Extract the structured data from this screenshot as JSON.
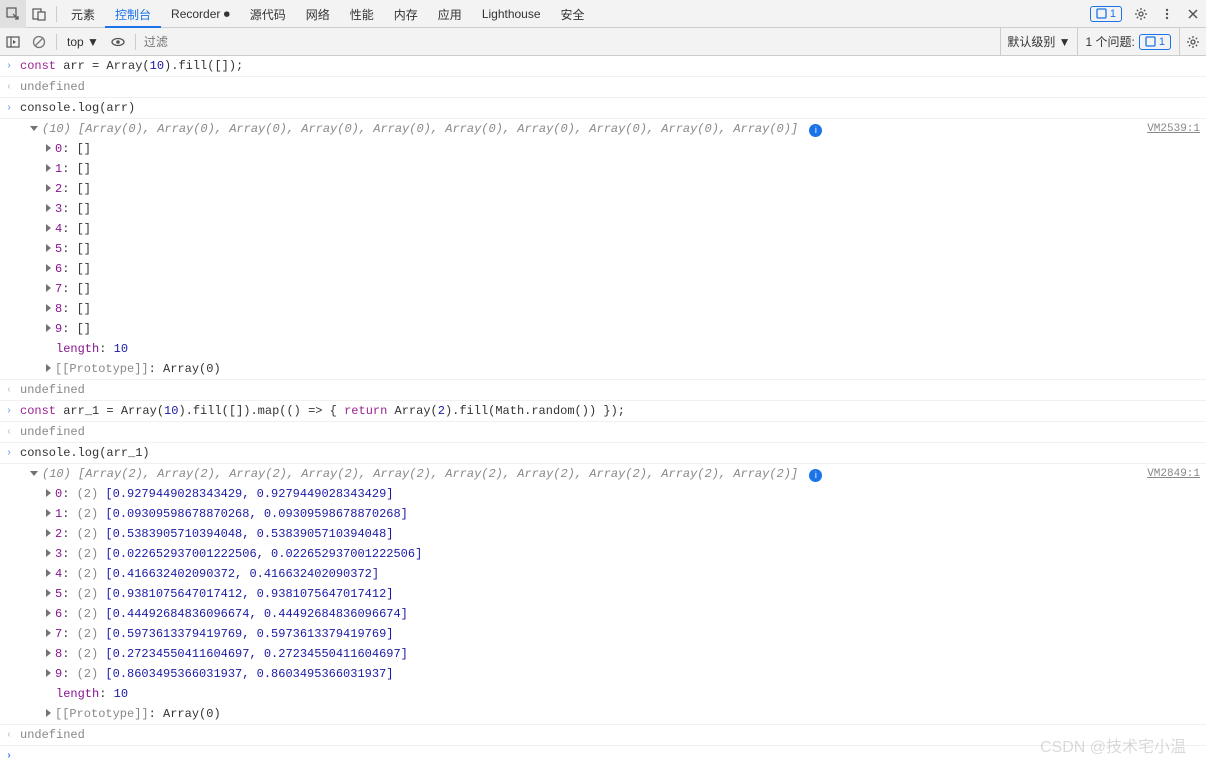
{
  "tabs": [
    "元素",
    "控制台",
    "Recorder ⏺",
    "源代码",
    "网络",
    "性能",
    "内存",
    "应用",
    "Lighthouse",
    "安全"
  ],
  "activeTab": "控制台",
  "issuesBadge": "1",
  "subbar": {
    "context": "top ▼",
    "filterPlaceholder": "过滤",
    "level": "默认级别 ▼",
    "issues": "1 个问题:",
    "issuesBadge": "1"
  },
  "lines": {
    "l1": "const arr = Array(10).fill([]);",
    "l2": "undefined",
    "l3": "console.log(arr)",
    "l4_summary": "(10) [Array(0), Array(0), Array(0), Array(0), Array(0), Array(0), Array(0), Array(0), Array(0), Array(0)]",
    "l4_source": "VM2539:1",
    "arr_items": [
      {
        "idx": "0",
        "val": "[]"
      },
      {
        "idx": "1",
        "val": "[]"
      },
      {
        "idx": "2",
        "val": "[]"
      },
      {
        "idx": "3",
        "val": "[]"
      },
      {
        "idx": "4",
        "val": "[]"
      },
      {
        "idx": "5",
        "val": "[]"
      },
      {
        "idx": "6",
        "val": "[]"
      },
      {
        "idx": "7",
        "val": "[]"
      },
      {
        "idx": "8",
        "val": "[]"
      },
      {
        "idx": "9",
        "val": "[]"
      }
    ],
    "length_label": "length",
    "length_val": "10",
    "proto_label": "[[Prototype]]",
    "proto_val": "Array(0)",
    "l5": "undefined",
    "l6": "const arr_1 = Array(10).fill([]).map(() => { return Array(2).fill(Math.random()) });",
    "l7": "undefined",
    "l8": "console.log(arr_1)",
    "l9_summary": "(10) [Array(2), Array(2), Array(2), Array(2), Array(2), Array(2), Array(2), Array(2), Array(2), Array(2)]",
    "l9_source": "VM2849:1",
    "arr1_items": [
      {
        "idx": "0",
        "count": "(2)",
        "v": "[0.9279449028343429, 0.9279449028343429]"
      },
      {
        "idx": "1",
        "count": "(2)",
        "v": "[0.09309598678870268, 0.09309598678870268]"
      },
      {
        "idx": "2",
        "count": "(2)",
        "v": "[0.5383905710394048, 0.5383905710394048]"
      },
      {
        "idx": "3",
        "count": "(2)",
        "v": "[0.022652937001222506, 0.022652937001222506]"
      },
      {
        "idx": "4",
        "count": "(2)",
        "v": "[0.416632402090372, 0.416632402090372]"
      },
      {
        "idx": "5",
        "count": "(2)",
        "v": "[0.9381075647017412, 0.9381075647017412]"
      },
      {
        "idx": "6",
        "count": "(2)",
        "v": "[0.44492684836096674, 0.44492684836096674]"
      },
      {
        "idx": "7",
        "count": "(2)",
        "v": "[0.5973613379419769, 0.5973613379419769]"
      },
      {
        "idx": "8",
        "count": "(2)",
        "v": "[0.27234550411604697, 0.27234550411604697]"
      },
      {
        "idx": "9",
        "count": "(2)",
        "v": "[0.8603495366031937, 0.8603495366031937]"
      }
    ],
    "l10": "undefined"
  },
  "watermark": "CSDN @技术宅小温"
}
